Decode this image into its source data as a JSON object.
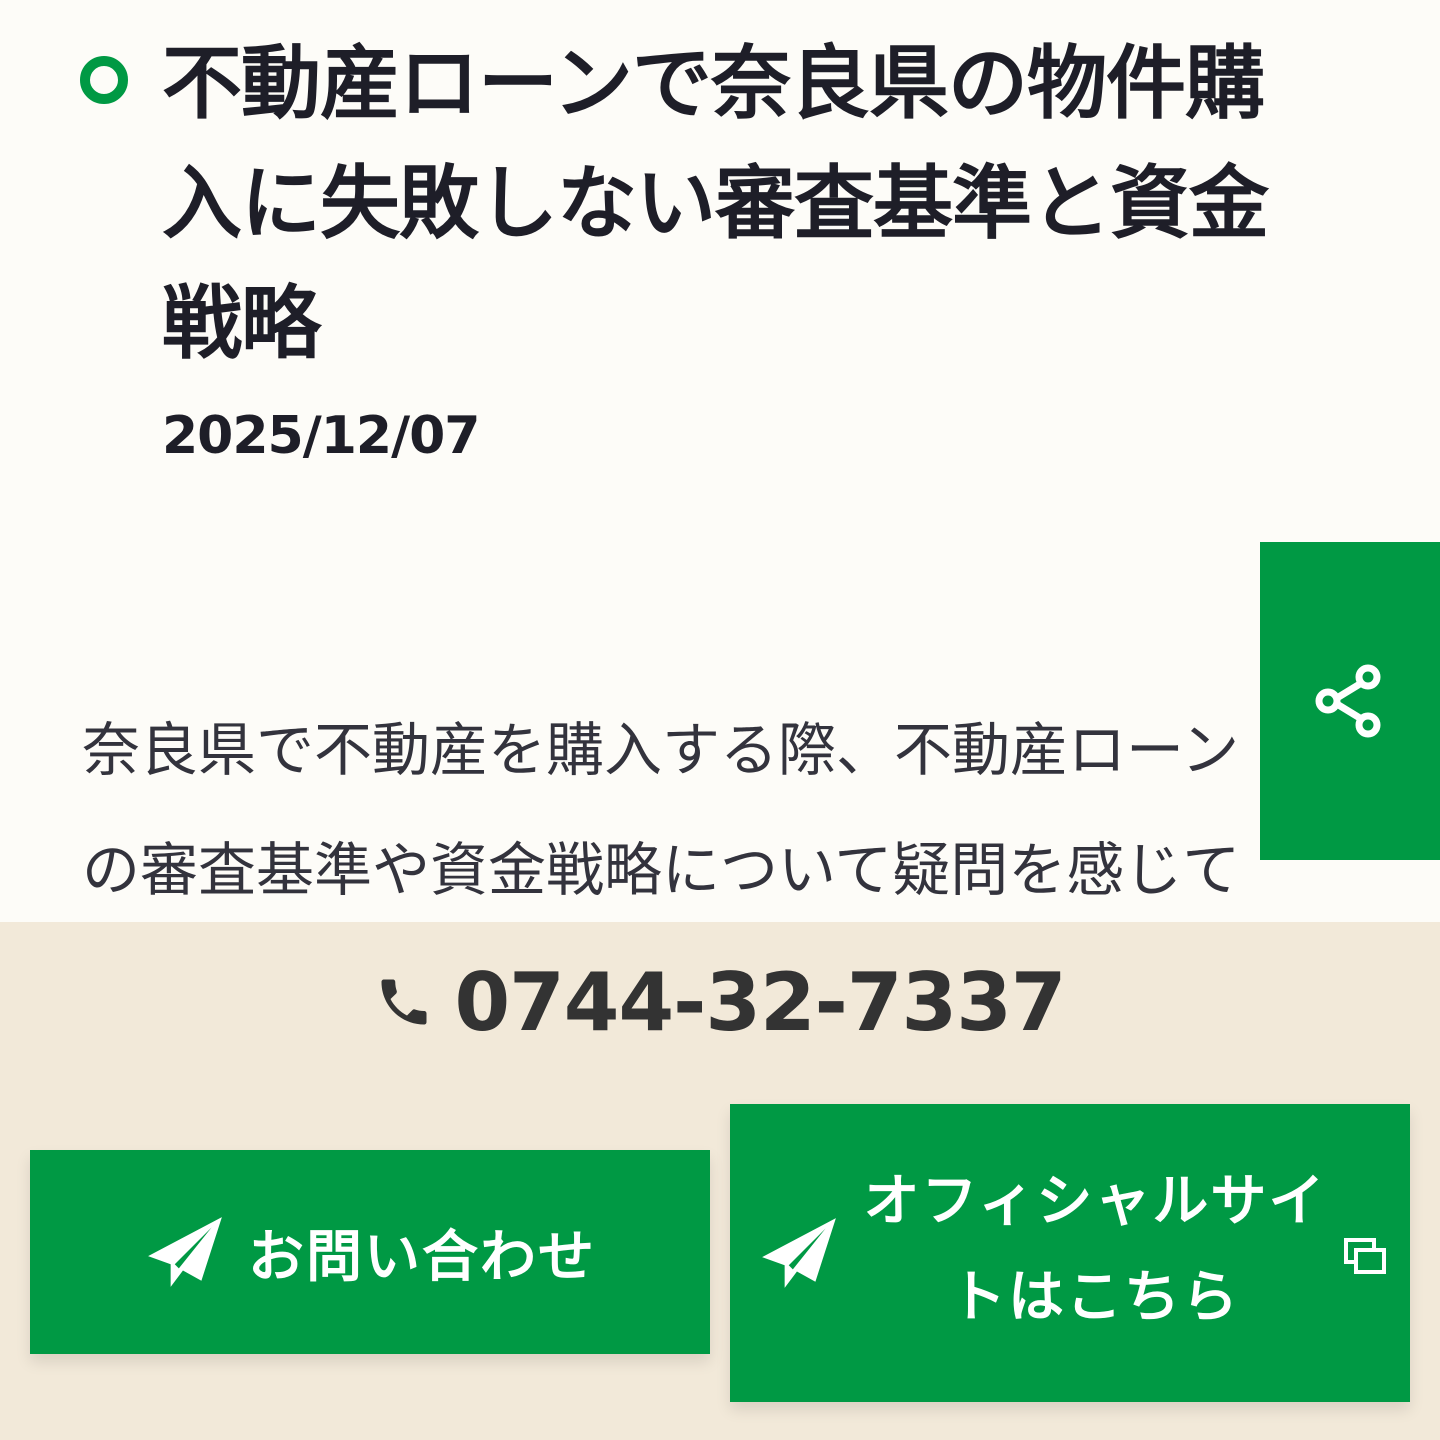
{
  "article": {
    "title": "不動産ローンで奈良県の物件購入に失敗しない審査基準と資金戦略",
    "date": "2025/12/07",
    "body_lines": [
      "奈良県で不動産を購入する際、不動産ローン",
      "の審査基準や資金戦略について疑問を感じて"
    ]
  },
  "share": {
    "icon": "share-icon"
  },
  "contact_bar": {
    "phone_icon": "phone-icon",
    "phone_number": "0744-32-7337",
    "contact_button_label": "お問い合わせ",
    "official_button_label": "オフィシャルサイトはこちら",
    "button_icon": "paper-plane-icon",
    "external_icon": "external-window-icon"
  },
  "colors": {
    "brand_green": "#009944",
    "bar_background": "#f2e9d9",
    "page_background": "#fdfcf8",
    "text_dark": "#1e1e28"
  }
}
